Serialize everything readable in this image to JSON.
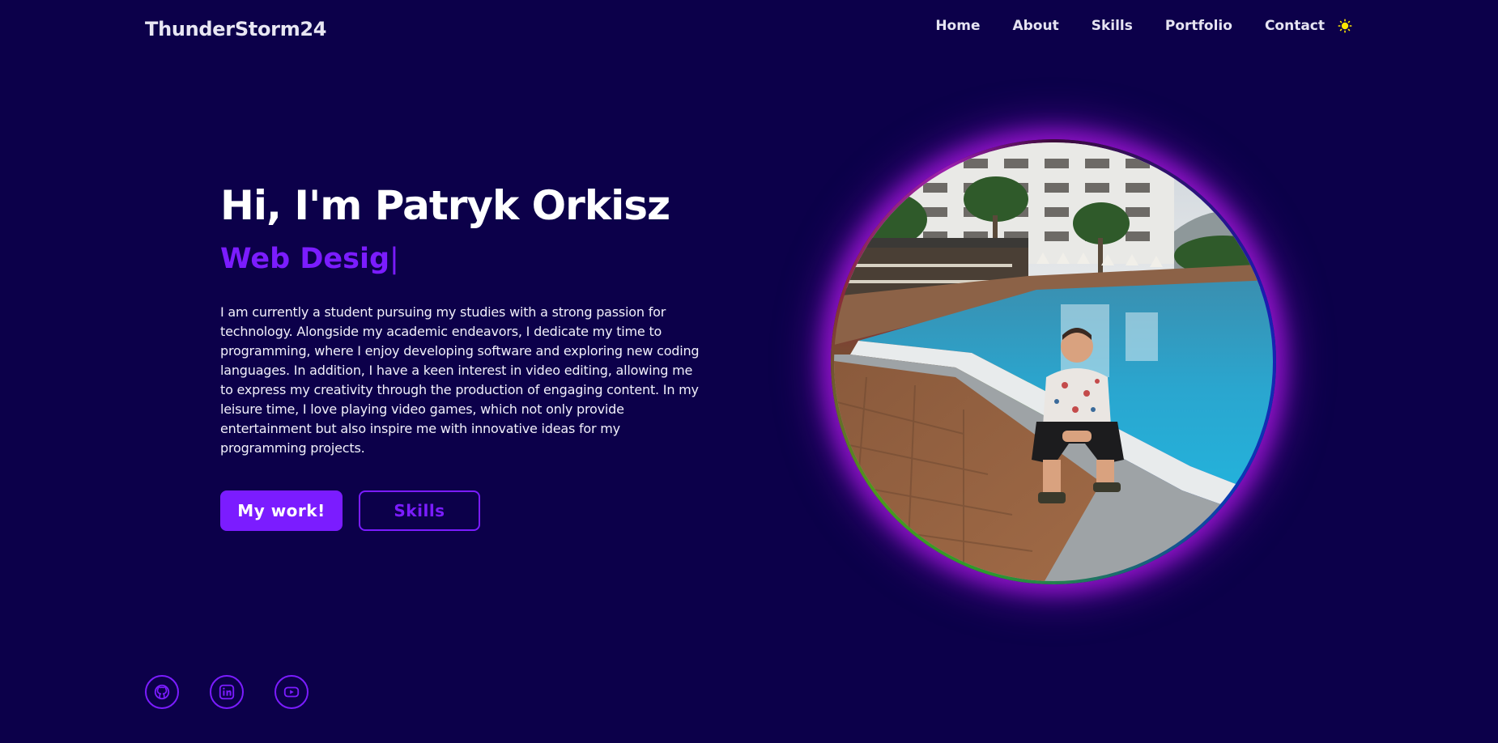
{
  "header": {
    "logo": "ThunderStorm24",
    "nav": [
      {
        "label": "Home"
      },
      {
        "label": "About"
      },
      {
        "label": "Skills"
      },
      {
        "label": "Portfolio"
      },
      {
        "label": "Contact"
      }
    ],
    "theme_icon": "sun-icon"
  },
  "hero": {
    "title": "Hi, I'm Patryk Orkisz",
    "role": "Web Desig",
    "cursor": "|",
    "description": "I am currently a student pursuing my studies with a strong passion for technology. Alongside my academic endeavors, I dedicate my time to programming, where I enjoy developing software and exploring new coding languages. In addition, I have a keen interest in video editing, allowing me to express my creativity through the production of engaging content. In my leisure time, I love playing video games, which not only provide entertainment but also inspire me with innovative ideas for my programming projects.",
    "primary_button": "My work!",
    "secondary_button": "Skills",
    "photo_icon": "profile-photo"
  },
  "social": [
    {
      "icon": "github-icon"
    },
    {
      "icon": "linkedin-icon"
    },
    {
      "icon": "youtube-icon"
    }
  ],
  "colors": {
    "background": "#0c004a",
    "accent": "#7b1cff",
    "text": "#ffffff",
    "sun": "#ffe600"
  }
}
